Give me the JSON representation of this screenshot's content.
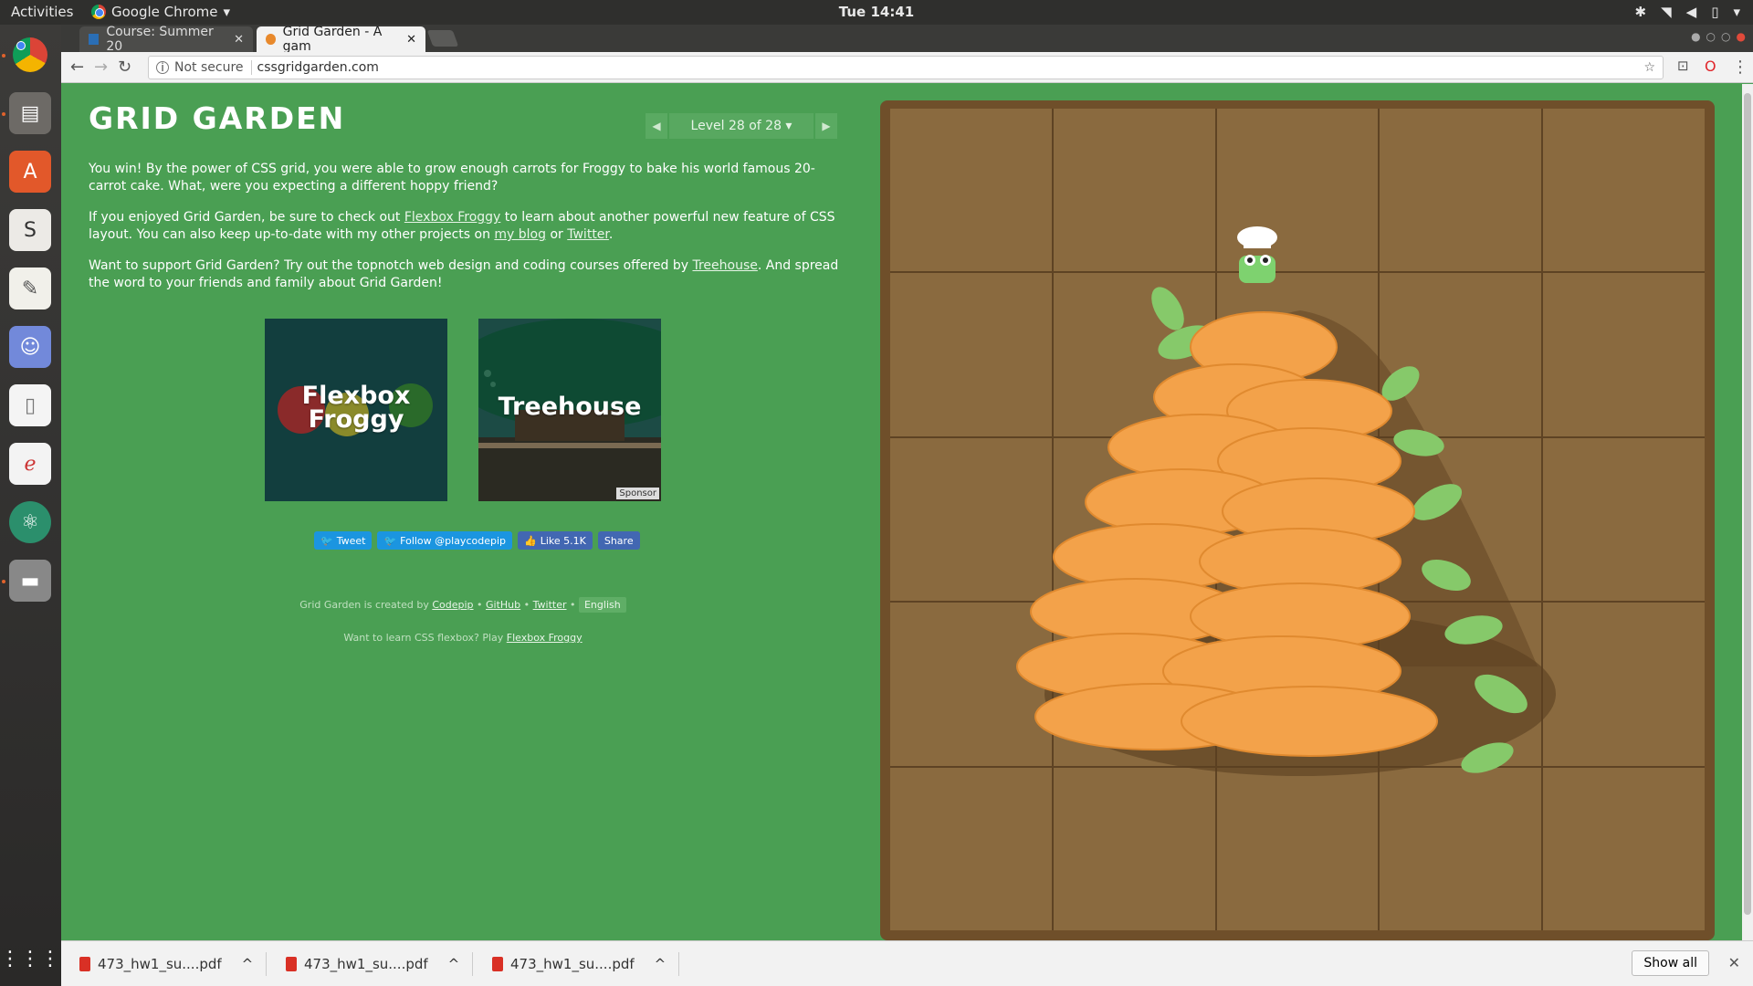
{
  "topbar": {
    "activities": "Activities",
    "app_name": "Google Chrome",
    "clock": "Tue 14:41"
  },
  "tabs": [
    {
      "title": "Course: Summer 20",
      "active": false
    },
    {
      "title": "Grid Garden - A gam",
      "active": true
    }
  ],
  "toolbar": {
    "security": "Not secure",
    "url": "cssgridgarden.com"
  },
  "page": {
    "title": "GRID GARDEN",
    "level": {
      "prev_icon": "◀",
      "label": "Level 28 of 28 ▾",
      "next_icon": "▶"
    },
    "para1": "You win! By the power of CSS grid, you were able to grow enough carrots for Froggy to bake his world famous 20-carrot cake. What, were you expecting a different hoppy friend?",
    "para2": {
      "t1": "If you enjoyed Grid Garden, be sure to check out ",
      "link_flexbox": "Flexbox Froggy",
      "t2": " to learn about another powerful new feature of CSS layout. You can also keep up-to-date with my other projects on ",
      "link_blog": "my blog",
      "t3": " or ",
      "link_twitter": "Twitter",
      "t4": "."
    },
    "para3": {
      "t1": "Want to support Grid Garden? Try out the topnotch web design and coding courses offered by ",
      "link_treehouse": "Treehouse",
      "t2": ". And spread the word to your friends and family about Grid Garden!"
    },
    "promos": {
      "flexbox_title_1": "Flexbox",
      "flexbox_title_2": "Froggy",
      "treehouse_title": "Treehouse",
      "sponsor": "Sponsor"
    },
    "social": {
      "tweet": "Tweet",
      "follow": "Follow @playcodepip",
      "like": "Like 5.1K",
      "share": "Share"
    },
    "footer": {
      "created_by": "Grid Garden is created by ",
      "codepip": "Codepip",
      "github": "GitHub",
      "twitter": "Twitter",
      "sep": " • ",
      "language": "English",
      "flexbox_prompt": "Want to learn CSS flexbox? Play ",
      "flexbox_link": "Flexbox Froggy"
    }
  },
  "downloads": {
    "items": [
      "473_hw1_su....pdf",
      "473_hw1_su....pdf",
      "473_hw1_su....pdf"
    ],
    "show_all": "Show all"
  }
}
